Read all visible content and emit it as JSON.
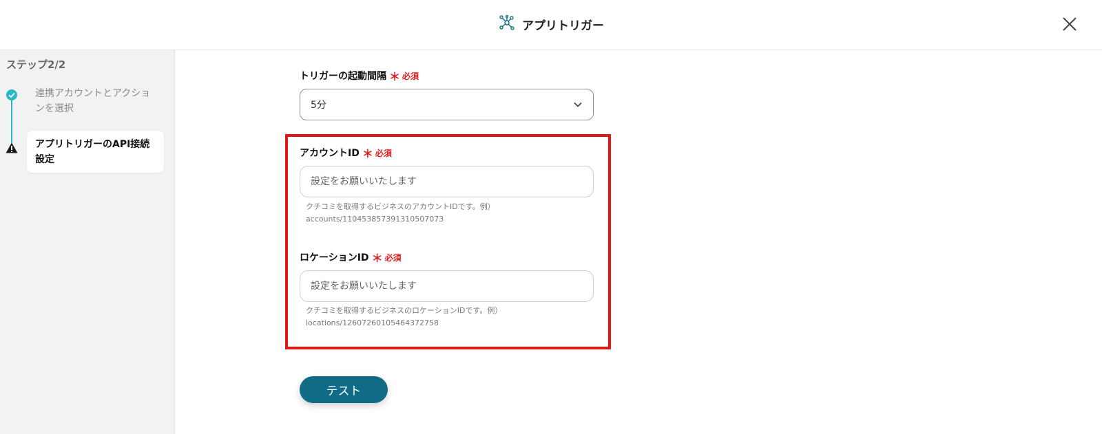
{
  "header": {
    "title": "アプリトリガー",
    "icon": "network-nodes-icon",
    "close_icon": "close-icon"
  },
  "sidebar": {
    "step_heading": "ステップ2/2",
    "steps": [
      {
        "label": "連携アカウントとアクションを選択",
        "status": "done"
      },
      {
        "label": "アプリトリガーのAPI接続設定",
        "status": "current"
      }
    ]
  },
  "form": {
    "interval": {
      "label": "トリガーの起動間隔",
      "required_mark": "＊",
      "required_text": "必須",
      "value": "5分"
    },
    "account_id": {
      "label": "アカウントID",
      "required_mark": "＊",
      "required_text": "必須",
      "placeholder": "設定をお願いいたします",
      "help_line1": "クチコミを取得するビジネスのアカウントIDです。例）",
      "help_line2": "accounts/110453857391310507073"
    },
    "location_id": {
      "label": "ロケーションID",
      "required_mark": "＊",
      "required_text": "必須",
      "placeholder": "設定をお願いいたします",
      "help_line1": "クチコミを取得するビジネスのロケーションIDです。例）",
      "help_line2": "locations/12607260105464372758"
    },
    "test_button": "テスト"
  },
  "colors": {
    "accent": "#0f6b86",
    "step_done": "#28b8c8",
    "required": "#e02020",
    "highlight": "#e01818"
  }
}
